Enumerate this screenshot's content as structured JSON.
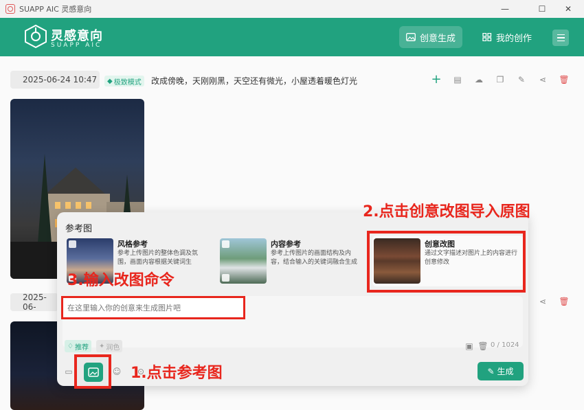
{
  "window": {
    "title": "SUAPP AIC 灵感意向"
  },
  "header": {
    "logo_title": "灵感意向",
    "logo_subtitle": "SUAPP AIC",
    "nav": [
      {
        "label": "创意生成",
        "active": true
      },
      {
        "label": "我的创作",
        "active": false
      }
    ]
  },
  "history": {
    "items": [
      {
        "timestamp": "2025-06-24 10:47",
        "mode_badge": "极致模式",
        "prompt": "改成傍晚，天刚刚黑，天空还有微光，小屋透着暖色灯光"
      },
      {
        "timestamp": "2025-06-"
      }
    ]
  },
  "panel": {
    "title": "参考图",
    "cards": [
      {
        "name": "风格参考",
        "desc": "参考上传图片的整体色调及氛围，画面内容根据关键词生"
      },
      {
        "name": "内容参考",
        "desc": "参考上传图片的画面结构及内容，结合输入的关键词融合生成"
      },
      {
        "name": "创意改图",
        "desc": "通过文字描述对图片上的内容进行创意修改"
      }
    ],
    "input_placeholder": "在这里输入你的创意来生成图片吧",
    "chip_recommend": "推荐",
    "chip_color": "润色",
    "counter": "0 / 1024",
    "generate_label": "生成"
  },
  "annotations": {
    "step1": "1.点击参考图",
    "step2": "2.点击创意改图导入原图",
    "step3": "3.输入改图命令"
  },
  "colors": {
    "brand": "#21a27f",
    "highlight": "#e8261d"
  }
}
